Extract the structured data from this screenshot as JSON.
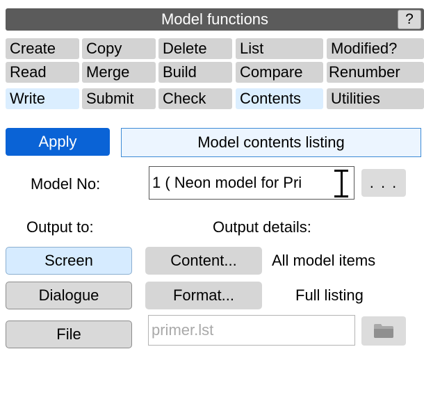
{
  "window": {
    "title": "Model functions",
    "help_label": "?"
  },
  "functions": {
    "row1": [
      {
        "label": "Create",
        "selected": false
      },
      {
        "label": "Copy",
        "selected": false
      },
      {
        "label": "Delete",
        "selected": false
      },
      {
        "label": "List",
        "selected": false
      },
      {
        "label": "Modified?",
        "selected": false
      }
    ],
    "row2": [
      {
        "label": "Read",
        "selected": false
      },
      {
        "label": "Merge",
        "selected": false
      },
      {
        "label": "Build",
        "selected": false
      },
      {
        "label": "Compare",
        "selected": false
      },
      {
        "label": "Renumber",
        "selected": false
      }
    ],
    "row3": [
      {
        "label": "Write",
        "selected": true
      },
      {
        "label": "Submit",
        "selected": false
      },
      {
        "label": "Check",
        "selected": false
      },
      {
        "label": "Contents",
        "selected": true
      },
      {
        "label": "Utilities",
        "selected": false
      }
    ]
  },
  "panel": {
    "apply_label": "Apply",
    "heading": "Model contents listing",
    "model_no_label": "Model No:",
    "model_no_value": "1 ( Neon model for Pri",
    "dots_label": ". . .",
    "output_to_label": "Output to:",
    "output_details_label": "Output details:",
    "output_targets": {
      "screen": {
        "label": "Screen",
        "selected": true
      },
      "dialogue": {
        "label": "Dialogue",
        "selected": false
      },
      "file": {
        "label": "File",
        "selected": false
      }
    },
    "content_button": "Content...",
    "content_value": "All model items",
    "format_button": "Format...",
    "format_value": "Full listing",
    "file_placeholder": "primer.lst",
    "folder_icon": "folder-icon"
  },
  "colors": {
    "titlebar": "#5b5b5b",
    "tab": "#d3d3d3",
    "tab_selected": "#dbeeff",
    "apply": "#0a63d6",
    "heading_border": "#3c8ad6"
  }
}
